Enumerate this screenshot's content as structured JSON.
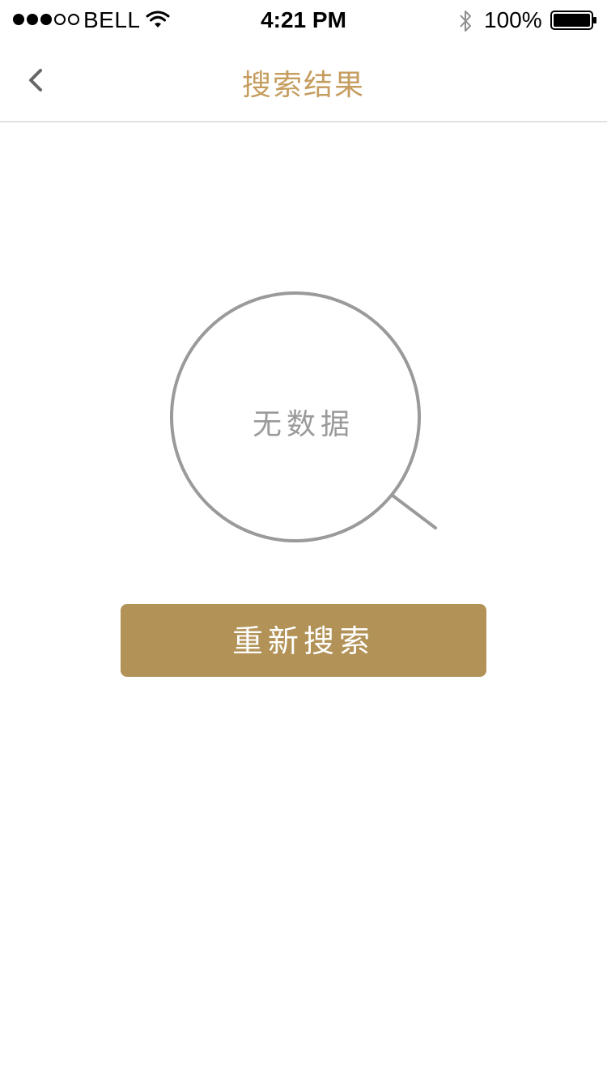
{
  "status_bar": {
    "carrier": "BELL",
    "time": "4:21 PM",
    "battery_percent": "100%",
    "signal_filled": 3,
    "signal_total": 5,
    "icons": [
      "wifi-icon",
      "bluetooth-icon",
      "battery-icon"
    ]
  },
  "nav": {
    "title": "搜索结果",
    "back_icon": "chevron-left-icon"
  },
  "empty_state": {
    "icon": "magnifier-icon",
    "message": "无数据"
  },
  "actions": {
    "research_label": "重新搜索"
  },
  "colors": {
    "accent_title": "#c59d5f",
    "button_bg": "#b29257",
    "icon_gray": "#9a9a9a"
  }
}
